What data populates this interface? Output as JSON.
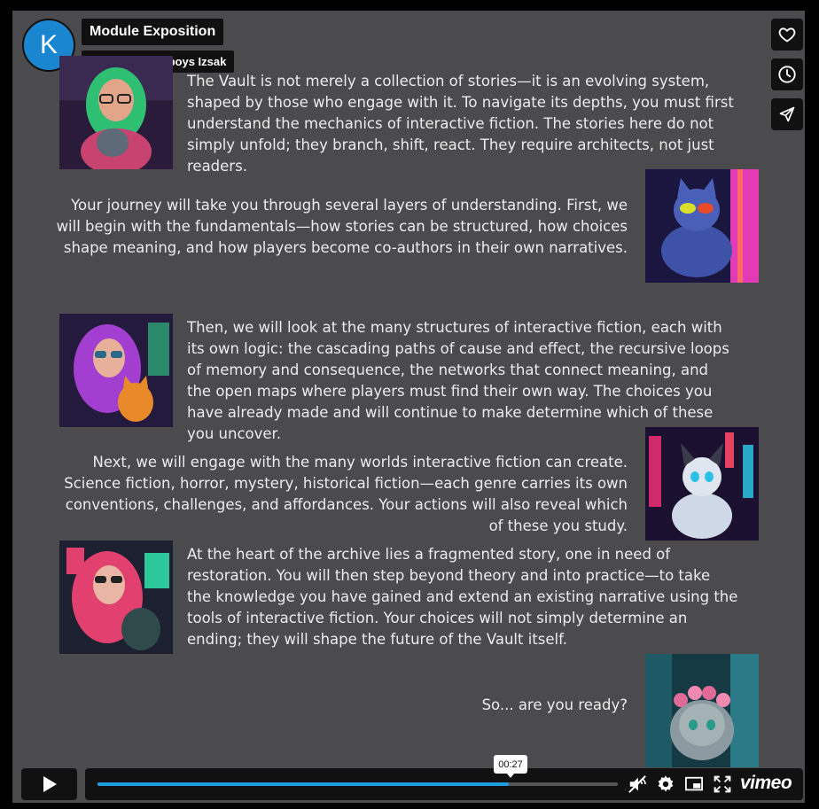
{
  "header": {
    "avatar_letter": "K",
    "title": "Module Exposition",
    "author": "Katherine Worboys Izsak"
  },
  "side_actions": [
    {
      "name": "like",
      "icon": "heart-icon"
    },
    {
      "name": "watch-later",
      "icon": "clock-icon"
    },
    {
      "name": "share",
      "icon": "paper-plane-icon"
    }
  ],
  "content": {
    "paragraphs": [
      "The Vault is not merely a collection of stories—it is an evolving system, shaped by those who engage with it. To navigate its depths, you must first understand the mechanics of interactive fiction. The stories here do not simply unfold; they branch, shift, react. They require architects, not just readers.",
      "Your journey will take you through several layers of understanding. First, we will begin with the fundamentals—how stories can be structured, how choices shape meaning, and how players become co-authors in their own narratives.",
      "Then, we will look at the many structures of interactive fiction, each with its own logic: the cascading paths of cause and effect, the recursive loops of memory and consequence, the networks that connect meaning, and the open maps where players must find their own way. The choices you have already made and will continue to make determine which of these you uncover.",
      "Next, we will engage with the many worlds interactive fiction can create. Science fiction, horror, mystery, historical fiction—each genre carries its own conventions, challenges, and affordances. Your actions will also reveal which of these you study.",
      "At the heart of the archive lies a fragmented story, one in need of restoration. You will then step beyond theory and into practice—to take the knowledge you have gained and extend an existing narrative using the tools of interactive fiction. Your choices will not simply determine an ending; they will shape the future of the Vault itself.",
      "So... are you ready?"
    ],
    "images": [
      {
        "name": "woman-green-hair-with-cat-image",
        "colors": [
          "#2a1b3a",
          "#29b86a",
          "#c8436f"
        ]
      },
      {
        "name": "cat-with-sunglasses-image",
        "colors": [
          "#1a1640",
          "#3e53a8",
          "#e23bb5"
        ]
      },
      {
        "name": "woman-purple-hair-with-orange-cat-image",
        "colors": [
          "#241a3e",
          "#a23ed0",
          "#e98a2a"
        ]
      },
      {
        "name": "siamese-cat-neon-city-image",
        "colors": [
          "#1b1030",
          "#d12a6b",
          "#2aa8c8"
        ]
      },
      {
        "name": "woman-pink-hair-with-cat-image",
        "colors": [
          "#1c2030",
          "#e2406e",
          "#2cc79a"
        ]
      },
      {
        "name": "kitten-with-flower-crown-image",
        "colors": [
          "#163a44",
          "#3aa3b0",
          "#e06a98"
        ]
      }
    ]
  },
  "player": {
    "current_time": "00:27",
    "progress": 0.79,
    "brand": "vimeo",
    "accent_color": "#1a9ee0"
  }
}
